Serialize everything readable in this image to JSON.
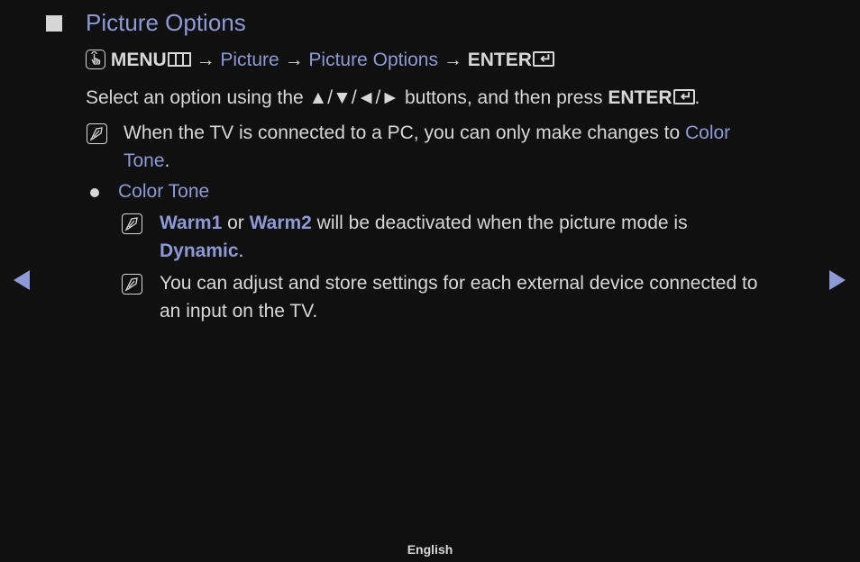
{
  "section": {
    "title": "Picture Options"
  },
  "menu_path": {
    "menu": "MENU",
    "arrow": "→",
    "step1": "Picture",
    "step2": "Picture Options",
    "enter": "ENTER"
  },
  "instruction": {
    "pre": "Select an option using the ▲/▼/◄/► buttons, and then press ",
    "enter": "ENTER",
    "post": "."
  },
  "note_pc": {
    "pre": "When the TV is connected to a PC, you can only make changes to ",
    "hl1": "Color",
    "hl2": "Tone",
    "post": "."
  },
  "bullet": {
    "label": "Color Tone"
  },
  "note_warm": {
    "hl1": "Warm1",
    "mid1": " or ",
    "hl2": "Warm2",
    "mid2": " will be deactivated when the picture mode is",
    "hl3": "Dynamic",
    "post": "."
  },
  "note_adjust": {
    "line1": "You can adjust and store settings for each external device connected to",
    "line2": "an input on the TV."
  },
  "navigation": {
    "prev": "previous-page",
    "next": "next-page"
  },
  "footer": {
    "language": "English"
  },
  "colors": {
    "accent": "#8d9ad6",
    "text": "#d8d8d8",
    "background": "#111010"
  }
}
